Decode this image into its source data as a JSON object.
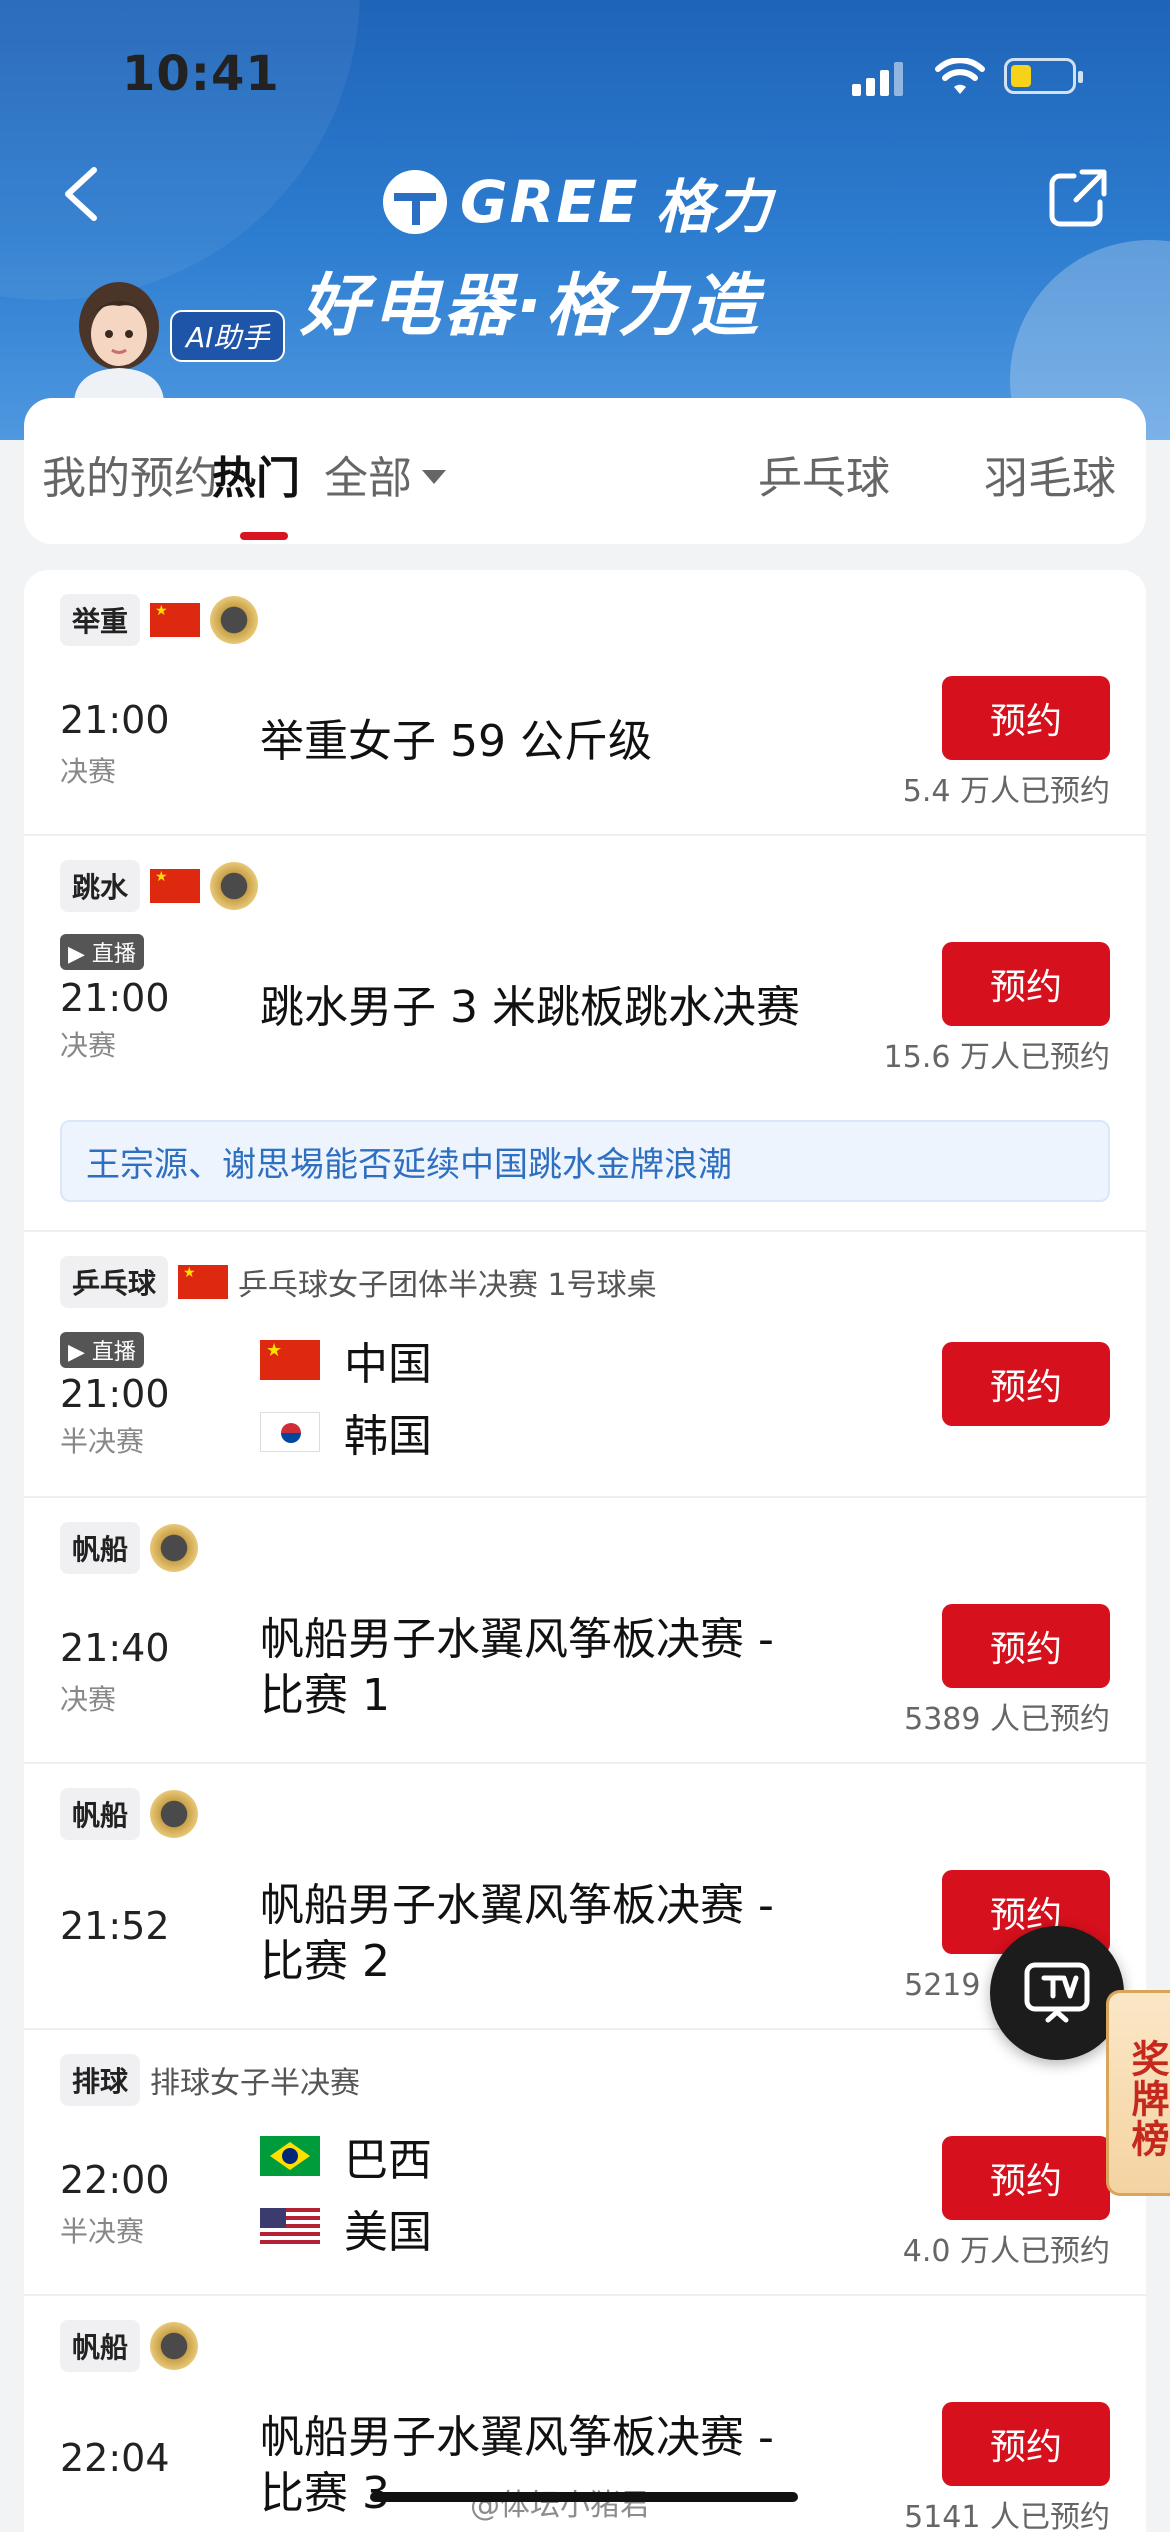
{
  "status": {
    "time": "10:41"
  },
  "header": {
    "brand_en": "GREE",
    "brand_cn": "格力",
    "slogan": "好电器·格力造",
    "ai_badge": "AI助手"
  },
  "tabs": [
    {
      "label": "我的预约"
    },
    {
      "label": "热门"
    },
    {
      "label": "全部"
    },
    {
      "label": "乒乓球"
    },
    {
      "label": "羽毛球"
    }
  ],
  "events": [
    {
      "sport": "举重",
      "time": "21:00",
      "stage": "决赛",
      "title": "举重女子 59 公斤级",
      "button": "预约",
      "count": "5.4 万人已预约"
    },
    {
      "sport": "跳水",
      "live": "▶ 直播",
      "time": "21:00",
      "stage": "决赛",
      "title": "跳水男子 3 米跳板跳水决赛",
      "button": "预约",
      "count": "15.6 万人已预约",
      "note": "王宗源、谢思埸能否延续中国跳水金牌浪潮"
    },
    {
      "sport": "乒乓球",
      "desc": "乒乓球女子团体半决赛 1号球桌",
      "live": "▶ 直播",
      "time": "21:00",
      "stage": "半决赛",
      "team1": "中国",
      "team2": "韩国",
      "button": "预约"
    },
    {
      "sport": "帆船",
      "time": "21:40",
      "stage": "决赛",
      "title_line1": "帆船男子水翼风筝板决赛 -",
      "title_line2": "比赛 1",
      "button": "预约",
      "count": "5389 人已预约"
    },
    {
      "sport": "帆船",
      "time": "21:52",
      "title_line1": "帆船男子水翼风筝板决赛 -",
      "title_line2": "比赛 2",
      "button": "预约",
      "count": "5219 人已预约"
    },
    {
      "sport": "排球",
      "desc": "排球女子半决赛",
      "time": "22:00",
      "stage": "半决赛",
      "team1": "巴西",
      "team2": "美国",
      "button": "预约",
      "count": "4.0 万人已预约"
    },
    {
      "sport": "帆船",
      "time": "22:04",
      "title_line1": "帆船男子水翼风筝板决赛 -",
      "title_line2": "比赛 3",
      "button": "预约",
      "count": "5141 人已预约"
    }
  ],
  "floating": {
    "medal_board": "奖牌榜"
  },
  "watermark": "@体坛小猪君",
  "colors": {
    "accent_red": "#d6101c",
    "header_blue": "#1f64b8",
    "note_blue": "#2f6fc0"
  }
}
